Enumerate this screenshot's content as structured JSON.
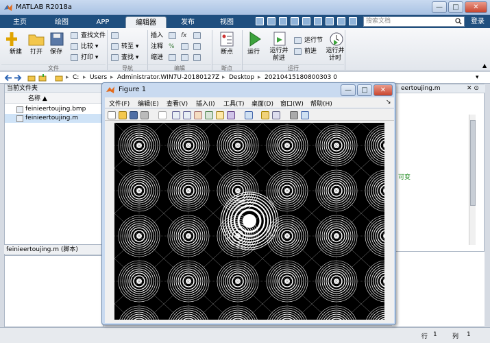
{
  "window": {
    "title": "MATLAB R2018a",
    "min": "—",
    "max": "□",
    "close": "✕"
  },
  "tabs": [
    {
      "label": "主页"
    },
    {
      "label": "绘图"
    },
    {
      "label": "APP"
    },
    {
      "label": "编辑器"
    },
    {
      "label": "发布"
    },
    {
      "label": "视图"
    }
  ],
  "search": {
    "placeholder": "搜索文档"
  },
  "login": "登录",
  "ribbon": {
    "file": {
      "new": "新建",
      "open": "打开",
      "save": "保存",
      "find_files": "查找文件",
      "compare": "比较",
      "print": "打印",
      "group": "文件"
    },
    "nav": {
      "goto": "转至",
      "find": "查找",
      "group": "导航"
    },
    "edit": {
      "insert": "插入",
      "comment": "注释",
      "indent": "缩进",
      "group": "编辑"
    },
    "breakpoints": {
      "label": "断点",
      "group": "断点"
    },
    "run": {
      "run": "运行",
      "run_advance": "运行并\n前进",
      "run_section": "运行节",
      "advance": "前进",
      "run_time": "运行并\n计时",
      "group": "运行"
    }
  },
  "address": {
    "parts": [
      "C:",
      "Users",
      "Administrator.WIN7U-20180127Z",
      "Desktop",
      "20210415180800303 0"
    ]
  },
  "current_folder": {
    "title": "当前文件夹",
    "col_name": "名称 ▲",
    "files": [
      {
        "name": "feinieertoujing.bmp",
        "selected": false
      },
      {
        "name": "feinieertoujing.m",
        "selected": true
      }
    ],
    "detail": "feinieertoujing.m  (脚本)"
  },
  "editor": {
    "tab": "eertoujing.m",
    "green_text": "可变"
  },
  "figure": {
    "title": "Figure 1",
    "menu": [
      "文件(F)",
      "编辑(E)",
      "查看(V)",
      "插入(I)",
      "工具(T)",
      "桌面(D)",
      "窗口(W)",
      "帮助(H)"
    ]
  },
  "status": {
    "row_label": "行",
    "row_value": "1",
    "col_label": "列",
    "col_value": "1"
  },
  "colors": {
    "tabbar": "#1f4f7f",
    "titlebar": "#b8cde9"
  }
}
